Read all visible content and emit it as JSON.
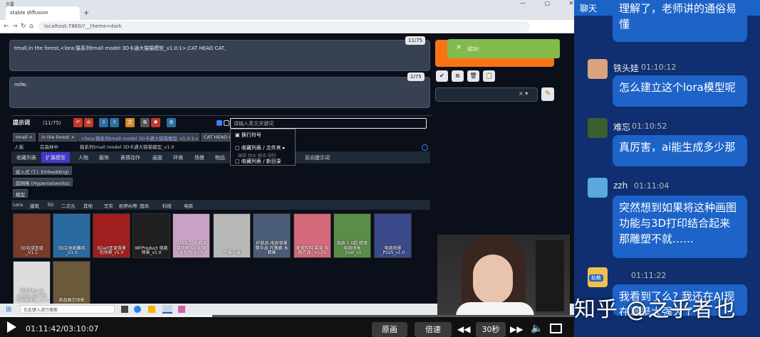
{
  "browser": {
    "window_title": "大雷",
    "tab_title": "stable diffusion",
    "url": "localhost:7860/?__theme=dark",
    "nav": [
      "←",
      "→",
      "↻",
      "⌂"
    ]
  },
  "prompt": {
    "positive": "tmall,in the forest,<lora:猫系列tmall model 3D卡通大猫猫模型_v1.0:1>,CAT HEAD CAT,",
    "positive_count": "11/75",
    "negative": "nsfw,",
    "negative_count": "2/75"
  },
  "generate": {
    "label": "生成",
    "toast": "成功!",
    "toast_close": "×"
  },
  "tools": [
    "✔",
    "⧉",
    "🗑",
    "📋"
  ],
  "style_select": {
    "clear": "×",
    "caret": "▾"
  },
  "helper": {
    "title": "提示词",
    "count": "(11/75)",
    "kw_placeholder": "请输入英文关键词",
    "kw_value": "",
    "chips": [
      "tmall ×",
      "in the forest ×",
      "<lora:猫系列tmall model 3D卡通大猫猫模型_v1.0:1> ×",
      "CAT HEAD CAT"
    ],
    "translations": [
      "人猫",
      "在森林中",
      "猫系列tmall model 3D卡通大猫猫模型_v1.0"
    ],
    "menu": [
      "换行符号",
      "收藏列表 / 文件夹",
      "收藏列表 / 新目录"
    ],
    "menu_arrow": "▸",
    "menu_bg_labels": [
      "编辑",
      "相似",
      "翻译",
      "删除"
    ],
    "cat_tabs": [
      "收藏列表",
      "扩展模型",
      "人物",
      "服饰",
      "表情动作",
      "画面",
      "环境",
      "场景",
      "物品",
      "...",
      "反向提示词"
    ],
    "sub_tags": [
      "嵌入式 (T.I. Embedding)",
      "超网络 (Hypernetworks)",
      "模型"
    ],
    "lora_tags": [
      "Lora",
      "建筑",
      "3D",
      "二次元",
      "其他",
      "写实",
      "机甲AI等",
      "国风",
      "科技",
      "电商"
    ]
  },
  "cards": [
    {
      "label": "3D合成圣诞_V1.1",
      "bg": "#7a3b2a"
    },
    {
      "label": "3D立体纸雕风_V1.0",
      "bg": "#2b6aa0"
    },
    {
      "label": "3Dart圣诞背景 包场景_v1.0",
      "bg": "#a01e1e"
    },
    {
      "label": "WFProduct 电商场景_v1.0",
      "bg": "#1f1f1f"
    },
    {
      "label": "【核实】 电商天猫风格 V1.0 美妆系列_v1.0",
      "bg": "#c9a1c4"
    },
    {
      "label": "大猫人猫",
      "bg": "#b8b8b8"
    },
    {
      "label": "护肤品-电商背景 精华品 在路面 水面画",
      "bg": "#4a5c78"
    },
    {
      "label": "美食饮料 零食 电商产品 _v1.01",
      "bg": "#d46a7a"
    },
    {
      "label": "电商 1.0超 精美电商场景_cool_v1",
      "bg": "#5a8c4a"
    },
    {
      "label": "电商场景_PLUS_v1.0",
      "bg": "#3a4a8a"
    },
    {
      "label": "猫系列tmall model 3D卡通大猫猫模型_v1.0",
      "bg": "#ddd"
    },
    {
      "label": "商品展示场景",
      "bg": "#6a5a3a"
    }
  ],
  "taskbar": {
    "search": "在此键入进行搜索"
  },
  "player": {
    "time": "01:11:42/03:10:07",
    "progress": 0.37,
    "buttons": [
      "原画",
      "倍速",
      "30秒"
    ]
  },
  "chat": {
    "header": "聊天",
    "messages": [
      {
        "name": "",
        "time": "",
        "text": "理解了，老师讲的通俗易懂",
        "avatar": "#6f87c0"
      },
      {
        "name": "铁头娃",
        "time": "01:10:12",
        "text": "怎么建立这个lora模型呢",
        "avatar": "#d9a37e"
      },
      {
        "name": "难忘",
        "time": "01:10:52",
        "text": "真厉害，ai能生成多少那",
        "avatar": "#3d5d2d"
      },
      {
        "name": "zzh",
        "time": "01:11:04",
        "text": "突然想到如果将这种画图功能与3D打印结合起来那雕塑不就……",
        "avatar": "#5aa8e0"
      },
      {
        "name": "",
        "time": "01:11:22",
        "text": "我看到了么? 我还在AI现在真是太强大了",
        "avatar": "#f0c04a"
      }
    ],
    "badge": "助教"
  },
  "watermark": "知乎 @之乎者也"
}
